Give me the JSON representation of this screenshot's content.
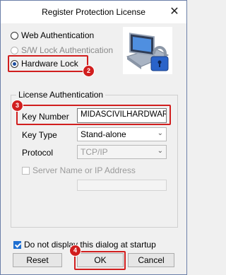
{
  "window": {
    "title": "Register Protection License"
  },
  "auth_options": [
    {
      "label": "Web Authentication",
      "checked": false,
      "disabled": false
    },
    {
      "label": "S/W Lock Authentication",
      "checked": false,
      "disabled": true
    },
    {
      "label": "Hardware Lock",
      "checked": true,
      "disabled": false
    }
  ],
  "badges": {
    "hardware_lock": "2",
    "key_number": "3",
    "ok": "4"
  },
  "license": {
    "group_title": "License Authentication",
    "key_number_label": "Key Number",
    "key_number_value": "MIDASCIVILHARDWARE",
    "key_type_label": "Key Type",
    "key_type_value": "Stand-alone",
    "protocol_label": "Protocol",
    "protocol_value": "TCP/IP",
    "server_label": "Server Name or IP Address"
  },
  "footer": {
    "dont_display_label": "Do not display this dialog at startup",
    "reset_label": "Reset",
    "ok_label": "OK",
    "cancel_label": "Cancel"
  },
  "icons": {
    "close": "close-icon",
    "logo": "license-lock-icon",
    "dropdown": "chevron-down-icon"
  },
  "colors": {
    "highlight": "#d11e1e",
    "accent": "#1f6fd1"
  }
}
